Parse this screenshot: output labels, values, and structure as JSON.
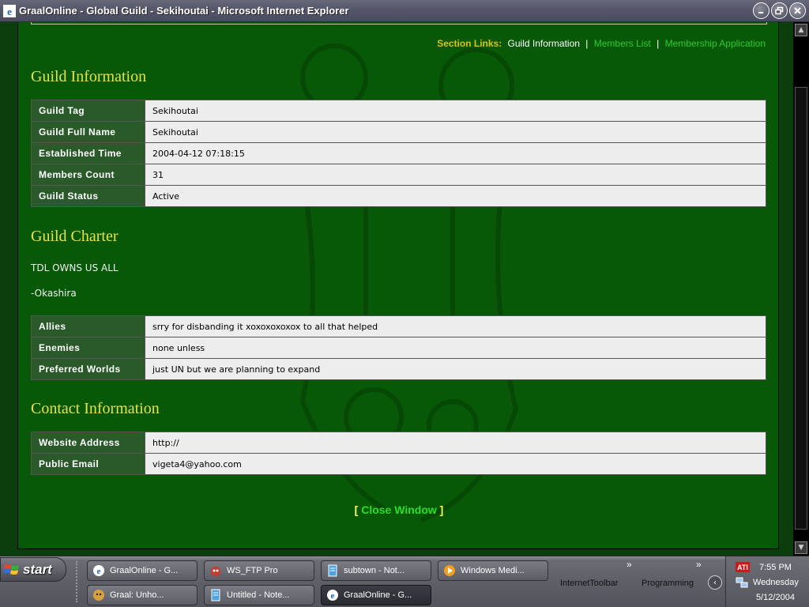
{
  "window": {
    "title": "GraalOnline - Global Guild - Sekihoutai - Microsoft Internet Explorer"
  },
  "section_links": {
    "label": "Section Links:",
    "current": "Guild Information",
    "links": [
      "Members List",
      "Membership Application"
    ]
  },
  "guild_info": {
    "heading": "Guild Information",
    "rows": [
      {
        "key": "Guild Tag",
        "value": "Sekihoutai"
      },
      {
        "key": "Guild Full Name",
        "value": "Sekihoutai"
      },
      {
        "key": "Established Time",
        "value": "2004-04-12 07:18:15"
      },
      {
        "key": "Members Count",
        "value": "31"
      },
      {
        "key": "Guild Status",
        "value": "Active"
      }
    ]
  },
  "charter": {
    "heading": "Guild Charter",
    "lines": [
      "TDL OWNS US ALL",
      "-Okashira"
    ],
    "rows": [
      {
        "key": "Allies",
        "value": "srry for disbanding it xoxoxoxoxox to all that helped"
      },
      {
        "key": "Enemies",
        "value": "none unless"
      },
      {
        "key": "Preferred Worlds",
        "value": "just UN but we are planning to expand"
      }
    ]
  },
  "contact": {
    "heading": "Contact Information",
    "rows": [
      {
        "key": "Website Address",
        "value": "http://"
      },
      {
        "key": "Public Email",
        "value": "vigeta4@yahoo.com"
      }
    ]
  },
  "close_window": {
    "open": "[",
    "label": "Close Window",
    "close": "]"
  },
  "taskbar": {
    "start_label": "start",
    "tasks": [
      {
        "label": "GraalOnline - G...",
        "icon": "ie-icon",
        "active": false
      },
      {
        "label": "WS_FTP Pro",
        "icon": "ftp-icon",
        "active": false
      },
      {
        "label": "subtown - Not...",
        "icon": "notepad-icon",
        "active": false
      },
      {
        "label": "Windows Medi...",
        "icon": "media-player-icon",
        "active": false
      },
      {
        "label": "Graal: Unho...",
        "icon": "graal-icon",
        "active": false
      },
      {
        "label": "Untitled - Note...",
        "icon": "notepad-icon",
        "active": false
      },
      {
        "label": "GraalOnline - G...",
        "icon": "ie-icon",
        "active": true
      }
    ],
    "toolbars": [
      "InternetToolbar",
      "Programming"
    ],
    "clock": {
      "time": "7:55 PM",
      "day": "Wednesday",
      "date": "5/12/2004"
    }
  },
  "colors": {
    "page_bg": "#075807",
    "heading": "#e8e24a",
    "key_cell": "#2a5a2a",
    "value_cell": "#ededed",
    "link": "#2fcc2f",
    "links_label": "#e0c200"
  }
}
